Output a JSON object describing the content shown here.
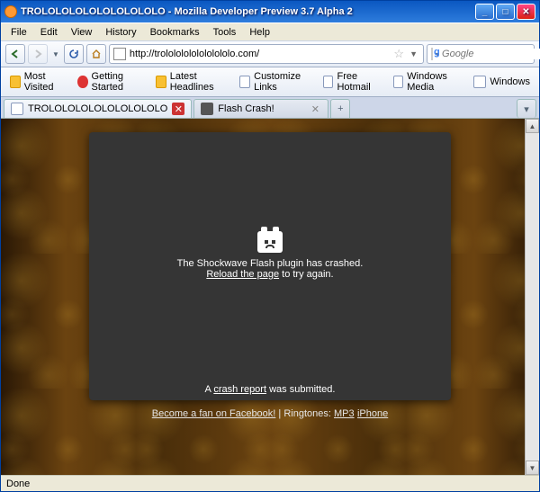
{
  "window": {
    "title": "TROLOLOLOLOLOLOLOLOLO - Mozilla Developer Preview 3.7 Alpha 2"
  },
  "menubar": [
    "File",
    "Edit",
    "View",
    "History",
    "Bookmarks",
    "Tools",
    "Help"
  ],
  "url": "http://trolololololololololo.com/",
  "search_placeholder": "Google",
  "bookmarks": [
    "Most Visited",
    "Getting Started",
    "Latest Headlines",
    "Customize Links",
    "Free Hotmail",
    "Windows Media",
    "Windows"
  ],
  "tabs": [
    {
      "label": "TROLOLOLOLOLOLOLOLOLO",
      "active": true
    },
    {
      "label": "Flash Crash!",
      "active": false
    }
  ],
  "crash": {
    "line1": "The Shockwave Flash plugin has crashed.",
    "reload_text": "Reload the page",
    "line2_suffix": " to try again.",
    "report_prefix": "A ",
    "report_link": "crash report",
    "report_suffix": " was submitted."
  },
  "bottom": {
    "fan": "Become a fan on Facebook!",
    "sep": " | ",
    "ring_label": "Ringtones: ",
    "ring1": "MP3",
    "ring2": "iPhone"
  },
  "status": "Done"
}
